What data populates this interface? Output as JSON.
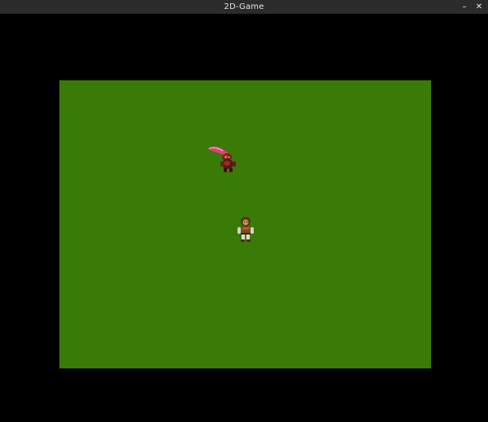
{
  "window": {
    "title": "2D-Game",
    "minimize_label": "–",
    "close_label": "✕",
    "minimize_icon": "minimize-icon",
    "close_icon": "close-icon"
  },
  "game": {
    "field_color": "#3a7a07",
    "background_color": "#000000",
    "sprites": [
      {
        "name": "enemy-goblin-sprite",
        "color": "#d4336c"
      },
      {
        "name": "player-character-sprite",
        "color": "#7a4a1f"
      }
    ]
  }
}
